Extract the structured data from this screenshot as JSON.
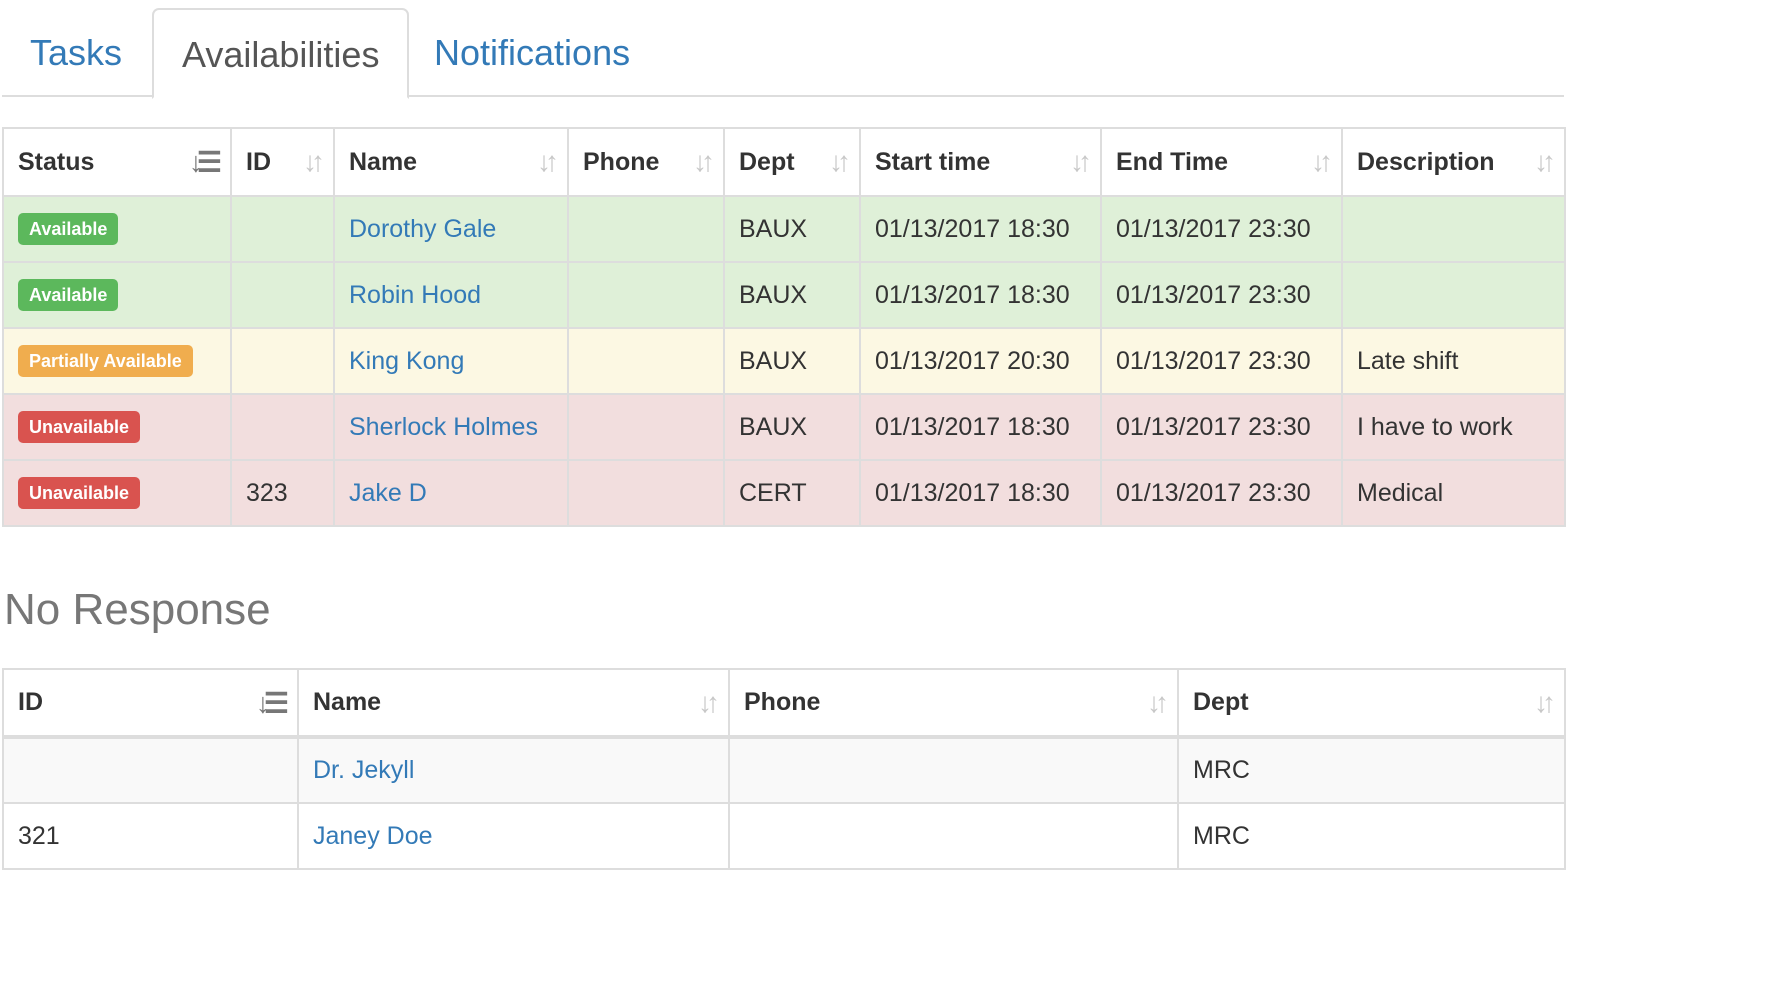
{
  "tabs": [
    {
      "label": "Tasks"
    },
    {
      "label": "Availabilities"
    },
    {
      "label": "Notifications"
    }
  ],
  "availability": {
    "columns": [
      "Status",
      "ID",
      "Name",
      "Phone",
      "Dept",
      "Start time",
      "End Time",
      "Description"
    ],
    "rows": [
      {
        "status": "Available",
        "id": "",
        "name": "Dorothy Gale",
        "phone": "",
        "dept": "BAUX",
        "start": "01/13/2017 18:30",
        "end": "01/13/2017 23:30",
        "description": ""
      },
      {
        "status": "Available",
        "id": "",
        "name": "Robin Hood",
        "phone": "",
        "dept": "BAUX",
        "start": "01/13/2017 18:30",
        "end": "01/13/2017 23:30",
        "description": ""
      },
      {
        "status": "Partially Available",
        "id": "",
        "name": "King Kong",
        "phone": "",
        "dept": "BAUX",
        "start": "01/13/2017 20:30",
        "end": "01/13/2017 23:30",
        "description": "Late shift"
      },
      {
        "status": "Unavailable",
        "id": "",
        "name": "Sherlock Holmes",
        "phone": "",
        "dept": "BAUX",
        "start": "01/13/2017 18:30",
        "end": "01/13/2017 23:30",
        "description": "I have to work"
      },
      {
        "status": "Unavailable",
        "id": "323",
        "name": "Jake D",
        "phone": "",
        "dept": "CERT",
        "start": "01/13/2017 18:30",
        "end": "01/13/2017 23:30",
        "description": "Medical"
      }
    ]
  },
  "no_response": {
    "title": "No Response",
    "columns": [
      "ID",
      "Name",
      "Phone",
      "Dept"
    ],
    "rows": [
      {
        "id": "",
        "name": "Dr. Jekyll",
        "phone": "",
        "dept": "MRC"
      },
      {
        "id": "321",
        "name": "Janey Doe",
        "phone": "",
        "dept": "MRC"
      }
    ]
  },
  "icons": {
    "sort_active": "sort-amount-icon",
    "sort_inactive": "sort-arrows-icon"
  },
  "colors": {
    "link": "#337ab7",
    "success_row": "#dff0d8",
    "warning_row": "#fcf8e3",
    "danger_row": "#f2dede",
    "label_success": "#5cb85c",
    "label_warning": "#f0ad4e",
    "label_danger": "#d9534f"
  }
}
